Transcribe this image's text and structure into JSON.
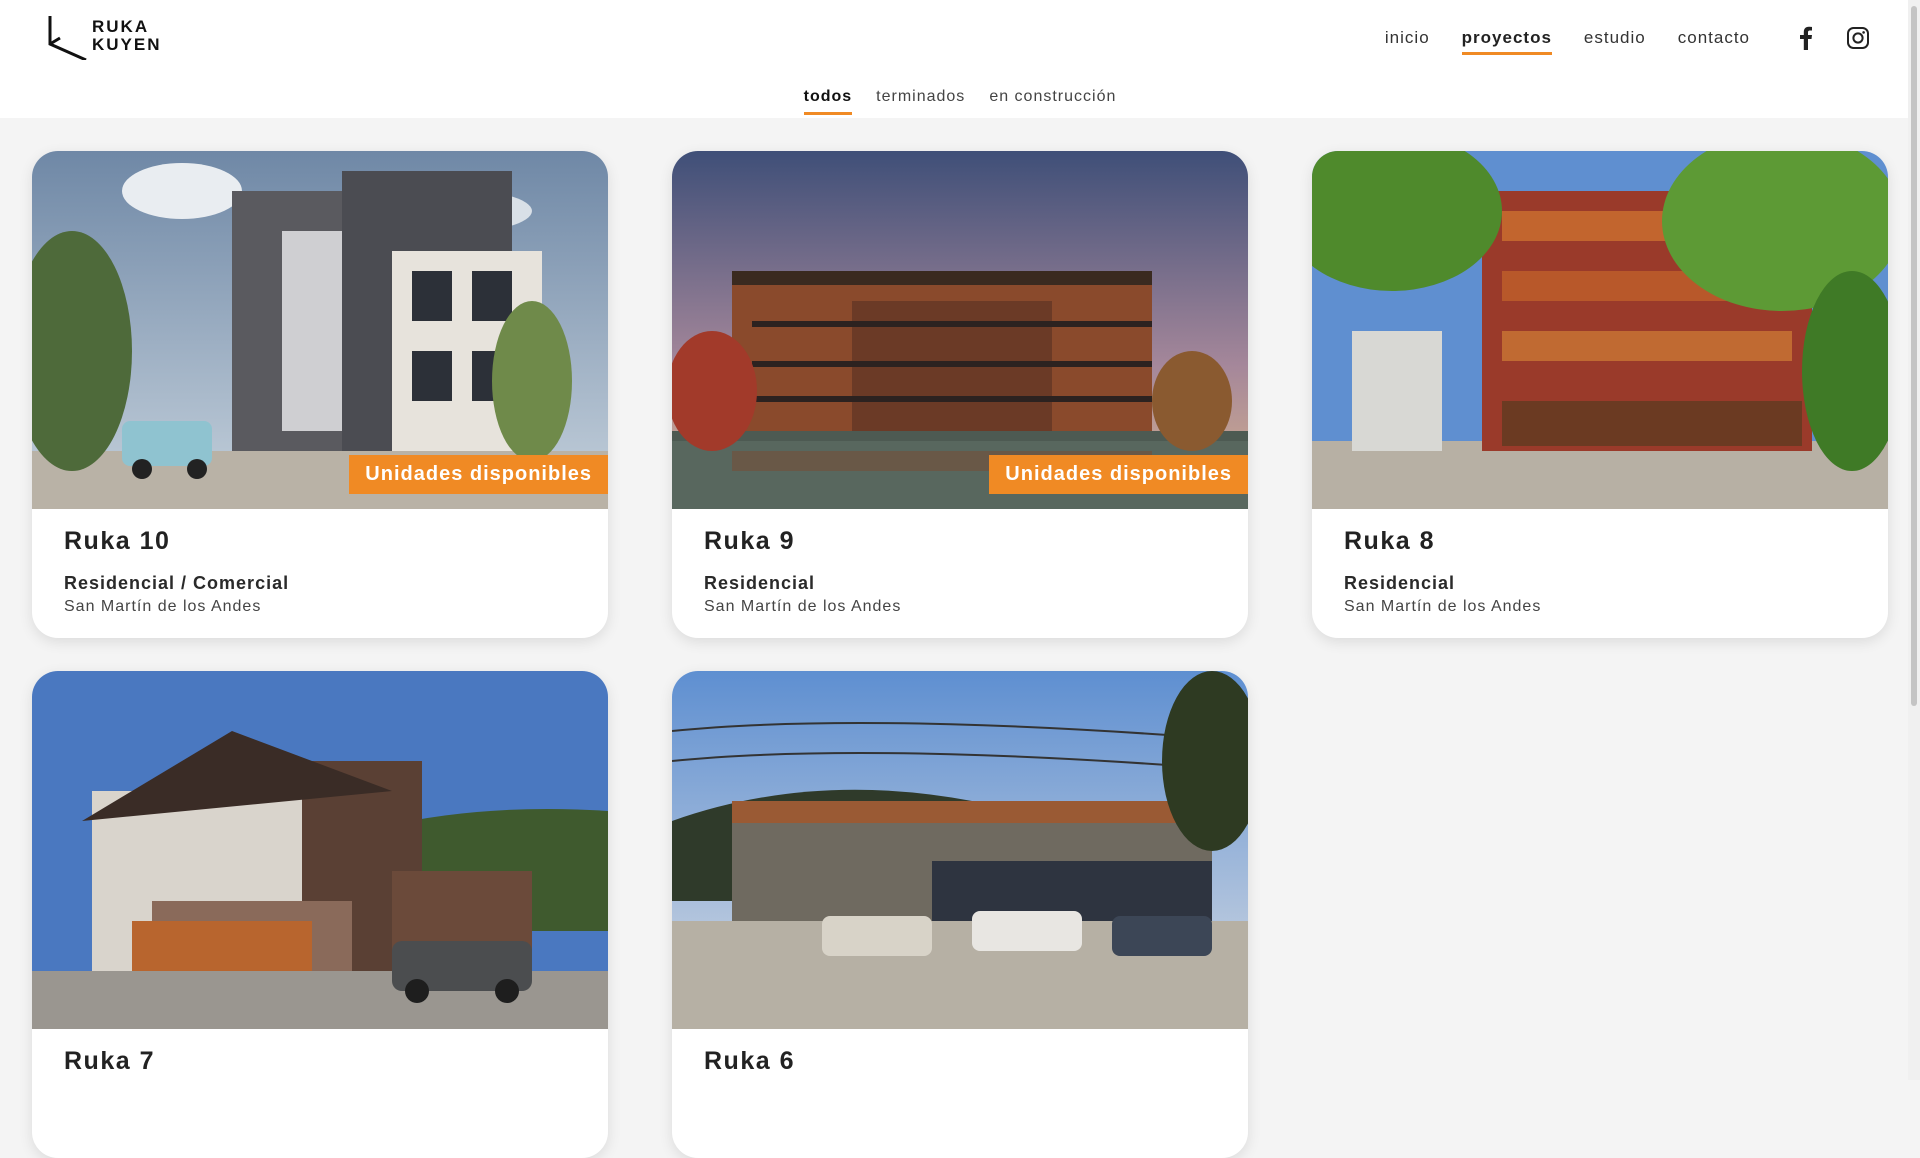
{
  "brand": {
    "line1": "RUKA",
    "line2": "KUYEN"
  },
  "nav": {
    "items": [
      {
        "label": "inicio",
        "active": false
      },
      {
        "label": "proyectos",
        "active": true
      },
      {
        "label": "estudio",
        "active": false
      },
      {
        "label": "contacto",
        "active": false
      }
    ]
  },
  "social": {
    "facebook": "facebook-icon",
    "instagram": "instagram-icon"
  },
  "filters": [
    {
      "label": "todos",
      "active": true
    },
    {
      "label": "terminados",
      "active": false
    },
    {
      "label": "en construcción",
      "active": false
    }
  ],
  "accent_color": "#f08a24",
  "projects": [
    {
      "title": "Ruka 10",
      "category": "Residencial / Comercial",
      "location": "San Martín de los Andes",
      "badge": "Unidades disponibles"
    },
    {
      "title": "Ruka 9",
      "category": "Residencial",
      "location": "San Martín de los Andes",
      "badge": "Unidades disponibles"
    },
    {
      "title": "Ruka 8",
      "category": "Residencial",
      "location": "San Martín de los Andes",
      "badge": ""
    },
    {
      "title": "Ruka 7",
      "category": "",
      "location": "",
      "badge": ""
    },
    {
      "title": "Ruka 6",
      "category": "",
      "location": "",
      "badge": ""
    }
  ]
}
